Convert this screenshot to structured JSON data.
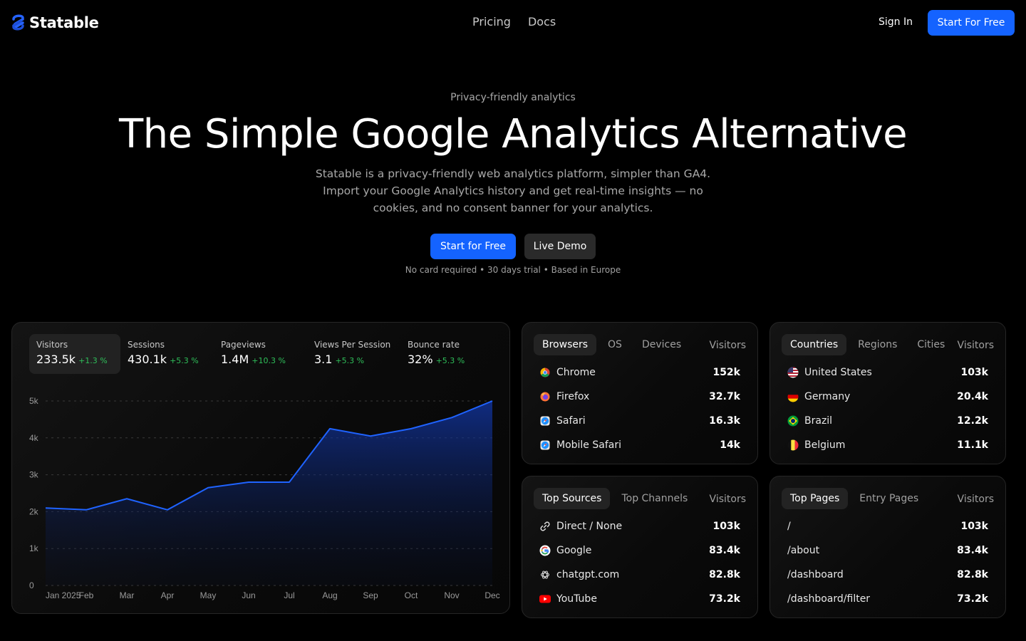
{
  "brand": {
    "name": "Statable",
    "accent": "#1463ff"
  },
  "nav": {
    "links": [
      "Pricing",
      "Docs"
    ],
    "sign_in": "Sign In",
    "cta": "Start For Free"
  },
  "hero": {
    "eyebrow": "Privacy-friendly analytics",
    "title": "The Simple Google Analytics Alternative",
    "subtitle": "Statable is a privacy-friendly web analytics platform, simpler than GA4. Import your Google Analytics history and get real-time insights — no cookies, and no consent banner for your analytics.",
    "primary_cta": "Start for Free",
    "secondary_cta": "Live Demo",
    "note": "No card required • 30 days trial • Based in Europe"
  },
  "stats": [
    {
      "label": "Visitors",
      "value": "233.5k",
      "change": "+1.3 %",
      "active": true
    },
    {
      "label": "Sessions",
      "value": "430.1k",
      "change": "+5.3 %"
    },
    {
      "label": "Pageviews",
      "value": "1.4M",
      "change": "+10.3 %"
    },
    {
      "label": "Views Per Session",
      "value": "3.1",
      "change": "+5.3 %"
    },
    {
      "label": "Bounce rate",
      "value": "32%",
      "change": "+5.3 %"
    }
  ],
  "chart_data": {
    "type": "area",
    "x": [
      "Jan 2025",
      "Feb",
      "Mar",
      "Apr",
      "May",
      "Jun",
      "Jul",
      "Aug",
      "Sep",
      "Oct",
      "Nov",
      "Dec"
    ],
    "x_ticks": [
      "Jan 2025",
      "Feb",
      "Mar",
      "Apr",
      "May",
      "Jun",
      "Jul",
      "Aug",
      "Sep",
      "Oct",
      "Nov",
      "Dec"
    ],
    "series": [
      {
        "values": [
          2100,
          2050,
          2350,
          2050,
          2650,
          2800,
          2800,
          4250,
          4050,
          4250,
          4550,
          5000
        ]
      }
    ],
    "y_ticks": [
      0,
      1000,
      2000,
      3000,
      4000,
      5000
    ],
    "y_tick_labels": [
      "0",
      "1k",
      "2k",
      "3k",
      "4k",
      "5k"
    ],
    "ylim": [
      0,
      5000
    ],
    "grid": true,
    "line_color": "#1f63ff"
  },
  "browsers": {
    "tabs": [
      "Browsers",
      "OS",
      "Devices"
    ],
    "column": "Visitors",
    "rows": [
      {
        "icon": "chrome-icon",
        "label": "Chrome",
        "value": "152k"
      },
      {
        "icon": "firefox-icon",
        "label": "Firefox",
        "value": "32.7k"
      },
      {
        "icon": "safari-icon",
        "label": "Safari",
        "value": "16.3k"
      },
      {
        "icon": "safari-icon",
        "label": "Mobile Safari",
        "value": "14k"
      }
    ]
  },
  "countries": {
    "tabs": [
      "Countries",
      "Regions",
      "Cities"
    ],
    "column": "Visitors",
    "rows": [
      {
        "icon": "us-flag-icon",
        "label": "United States",
        "value": "103k"
      },
      {
        "icon": "de-flag-icon",
        "label": "Germany",
        "value": "20.4k"
      },
      {
        "icon": "br-flag-icon",
        "label": "Brazil",
        "value": "12.2k"
      },
      {
        "icon": "be-flag-icon",
        "label": "Belgium",
        "value": "11.1k"
      }
    ]
  },
  "sources": {
    "tabs": [
      "Top Sources",
      "Top Channels"
    ],
    "column": "Visitors",
    "rows": [
      {
        "icon": "link-icon",
        "label": "Direct / None",
        "value": "103k"
      },
      {
        "icon": "google-icon",
        "label": "Google",
        "value": "83.4k"
      },
      {
        "icon": "openai-icon",
        "label": "chatgpt.com",
        "value": "82.8k"
      },
      {
        "icon": "youtube-icon",
        "label": "YouTube",
        "value": "73.2k"
      }
    ]
  },
  "pages": {
    "tabs": [
      "Top Pages",
      "Entry Pages"
    ],
    "column": "Visitors",
    "rows": [
      {
        "label": "/",
        "value": "103k"
      },
      {
        "label": "/about",
        "value": "83.4k"
      },
      {
        "label": "/dashboard",
        "value": "82.8k"
      },
      {
        "label": "/dashboard/filter",
        "value": "73.2k"
      }
    ]
  }
}
